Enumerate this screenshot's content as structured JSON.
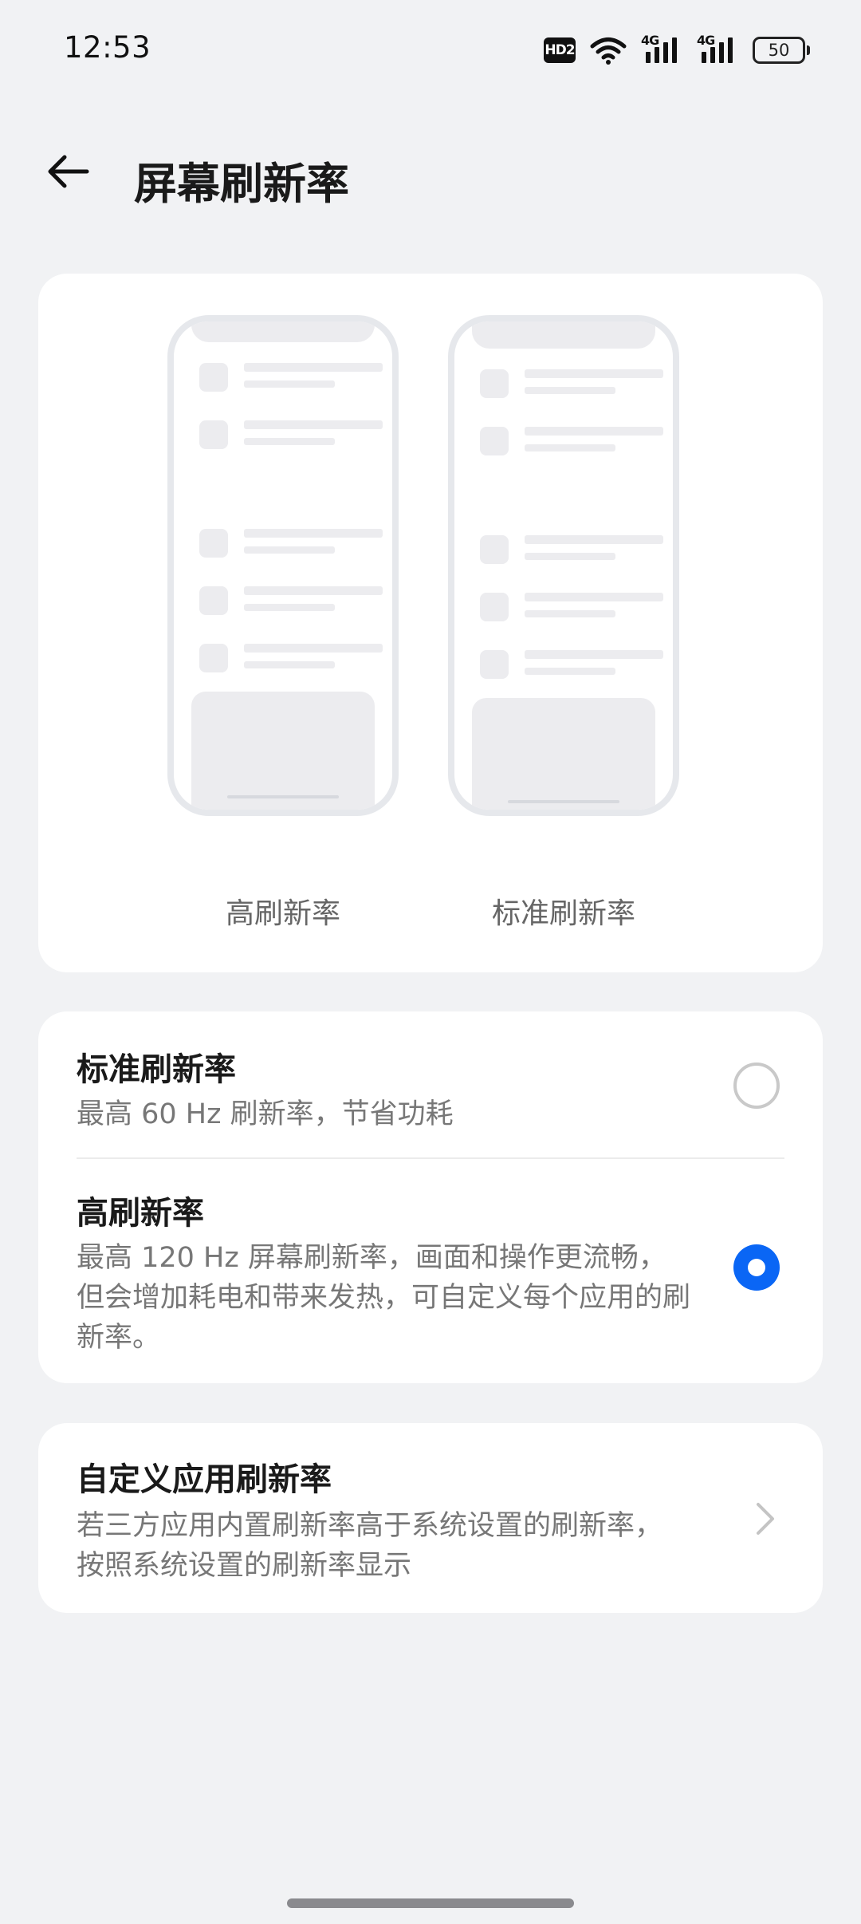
{
  "status_bar": {
    "time": "12:53",
    "hd_badge": "HD2",
    "signal_1_label": "4G",
    "signal_2_label": "4G",
    "battery_level": "50"
  },
  "header": {
    "title": "屏幕刷新率"
  },
  "preview": {
    "left_label": "高刷新率",
    "right_label": "标准刷新率"
  },
  "options": [
    {
      "title": "标准刷新率",
      "description": "最高 60 Hz 刷新率，节省功耗",
      "selected": false
    },
    {
      "title": "高刷新率",
      "description": "最高 120 Hz 屏幕刷新率，画面和操作更流畅，但会增加耗电和带来发热，可自定义每个应用的刷新率。",
      "selected": true
    }
  ],
  "custom": {
    "title": "自定义应用刷新率",
    "description": "若三方应用内置刷新率高于系统设置的刷新率，按照系统设置的刷新率显示"
  },
  "colors": {
    "accent": "#0a66f5",
    "background": "#f1f2f4",
    "card": "#ffffff"
  }
}
